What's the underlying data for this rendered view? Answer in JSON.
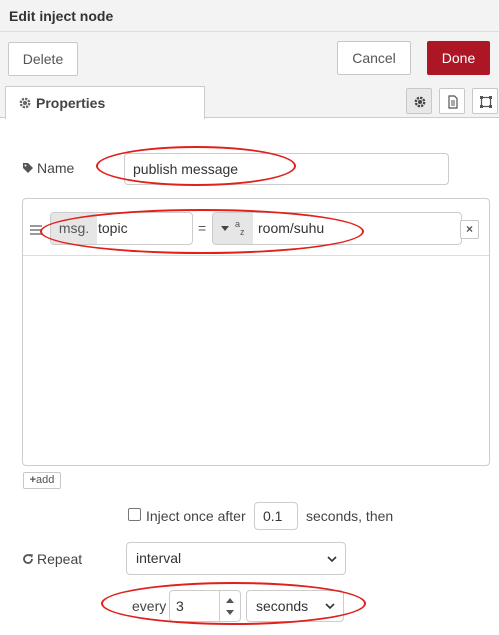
{
  "dialog": {
    "title": "Edit inject node"
  },
  "toolbar": {
    "delete_label": "Delete",
    "cancel_label": "Cancel",
    "done_label": "Done"
  },
  "tabs": {
    "properties_label": "Properties",
    "icons": [
      "gear-icon",
      "document-icon",
      "frame-icon"
    ]
  },
  "form": {
    "name_label": "Name",
    "name_value": "publish message",
    "properties": [
      {
        "prefix": "msg.",
        "key": "topic",
        "operator": "=",
        "type_icon": "a-z",
        "value": "room/suhu"
      }
    ],
    "remove_label": "×",
    "add_label": "add",
    "inject_once_label": "Inject once after",
    "inject_once_checked": false,
    "inject_once_value": "0.1",
    "inject_once_suffix": "seconds, then",
    "repeat_label": "Repeat",
    "repeat_value": "interval",
    "every_label": "every",
    "every_value": "3",
    "units_value": "seconds"
  },
  "colors": {
    "accent": "#ad1625",
    "annotation": "#e0201b"
  }
}
